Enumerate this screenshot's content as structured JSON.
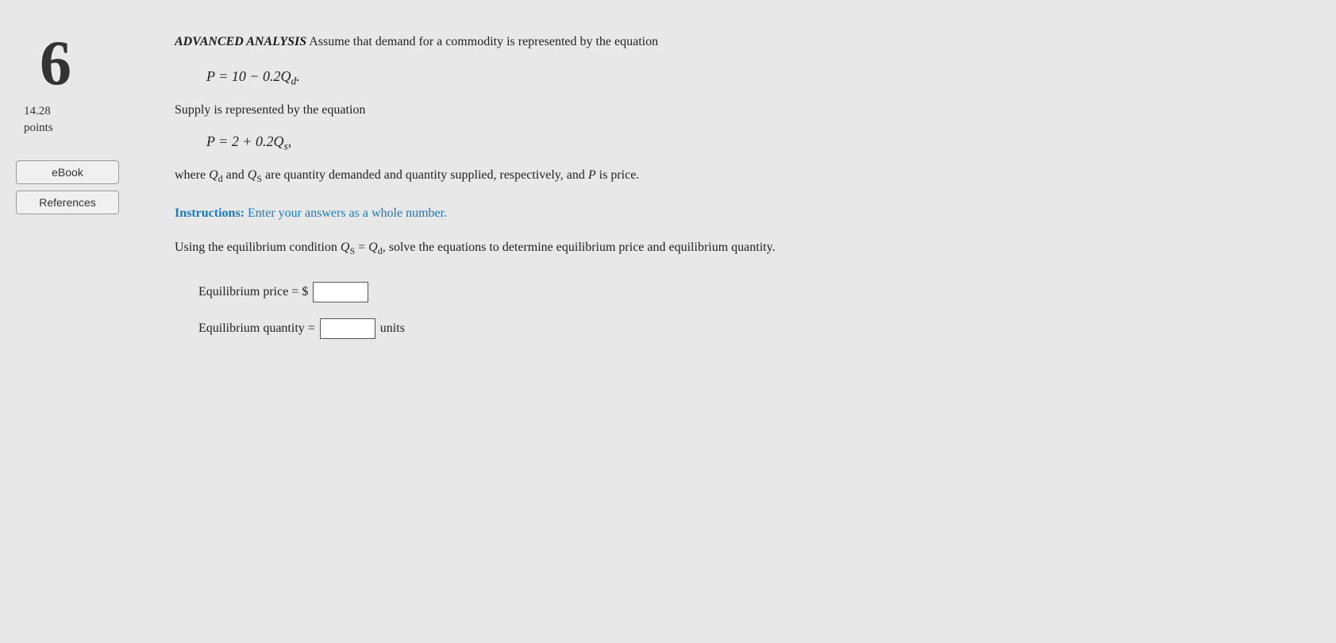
{
  "sidebar": {
    "question_number": "6",
    "points_value": "14.28",
    "points_label": "points",
    "ebook_button": "eBook",
    "references_button": "References"
  },
  "main": {
    "advanced_label": "ADVANCED ANALYSIS",
    "intro_text": " Assume that demand for a commodity is represented by the equation",
    "demand_equation": "P = 10 − 0.2Q",
    "demand_subscript": "d",
    "demand_suffix": ".",
    "supply_intro": "Supply is represented by the equation",
    "supply_equation": "P = 2 + 0.2Q",
    "supply_subscript": "s",
    "supply_suffix": ",",
    "description": "where Q",
    "description_sub_d": "d",
    "description_and": "and Q",
    "description_sub_s": "S",
    "description_rest": " are quantity demanded and quantity supplied, respectively, and ",
    "description_p": "P",
    "description_end": " is price.",
    "instructions_label": "Instructions:",
    "instructions_text": " Enter your answers as a whole number.",
    "equilibrium_text_1": "Using the equilibrium condition Q",
    "equilibrium_sub_s": "S",
    "equilibrium_equals": " = Q",
    "equilibrium_sub_d": "d",
    "equilibrium_text_2": ", solve the equations to determine equilibrium price and equilibrium quantity.",
    "price_label": "Equilibrium price = $",
    "quantity_label": "Equilibrium quantity = ",
    "units_label": "units",
    "price_input_value": "",
    "quantity_input_value": "",
    "price_input_placeholder": "",
    "quantity_input_placeholder": ""
  }
}
